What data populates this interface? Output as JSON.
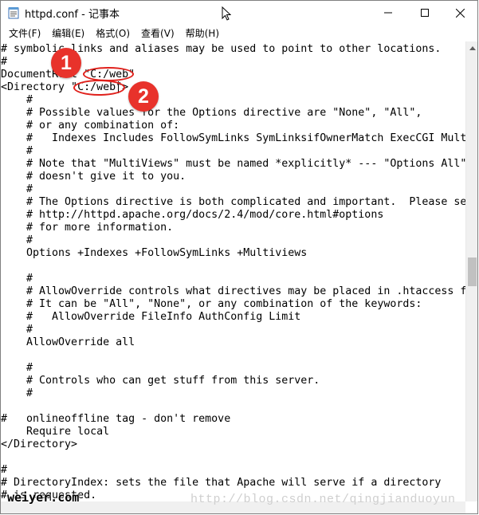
{
  "window": {
    "title": "httpd.conf - 记事本"
  },
  "menu": [
    "文件(F)",
    "编辑(E)",
    "格式(O)",
    "查看(V)",
    "帮助(H)"
  ],
  "editor_lines": [
    "# symbolic links and aliases may be used to point to other locations.",
    "#",
    "DocumentRoot \"C:/web\"",
    "<Directory \"C:/web\">",
    "    #",
    "    # Possible values for the Options directive are \"None\", \"All\",",
    "    # or any combination of:",
    "    #   Indexes Includes FollowSymLinks SymLinksifOwnerMatch ExecCGI MultiViews",
    "    #",
    "    # Note that \"MultiViews\" must be named *explicitly* --- \"Options All\"",
    "    # doesn't give it to you.",
    "    #",
    "    # The Options directive is both complicated and important.  Please see",
    "    # http://httpd.apache.org/docs/2.4/mod/core.html#options",
    "    # for more information.",
    "    #",
    "    Options +Indexes +FollowSymLinks +Multiviews",
    "",
    "    #",
    "    # AllowOverride controls what directives may be placed in .htaccess files.",
    "    # It can be \"All\", \"None\", or any combination of the keywords:",
    "    #   AllowOverride FileInfo AuthConfig Limit",
    "    #",
    "    AllowOverride all",
    "",
    "    #",
    "    # Controls who can get stuff from this server.",
    "    #",
    "",
    "#   onlineoffline tag - don't remove",
    "    Require local",
    "</Directory>",
    "",
    "#",
    "# DirectoryIndex: sets the file that Apache will serve if a directory",
    "# is requested."
  ],
  "annotations": {
    "badge1": "1",
    "badge2": "2",
    "color": "#e8322b"
  },
  "watermark": {
    "left": "weiyer.com",
    "right": "http://blog.csdn.net/qingjianduoyun"
  },
  "icons": {
    "app": "notepad-icon",
    "minimize": "minimize-icon",
    "maximize": "maximize-icon",
    "close": "close-icon",
    "scroll_up": "scroll-up-arrow-icon"
  }
}
